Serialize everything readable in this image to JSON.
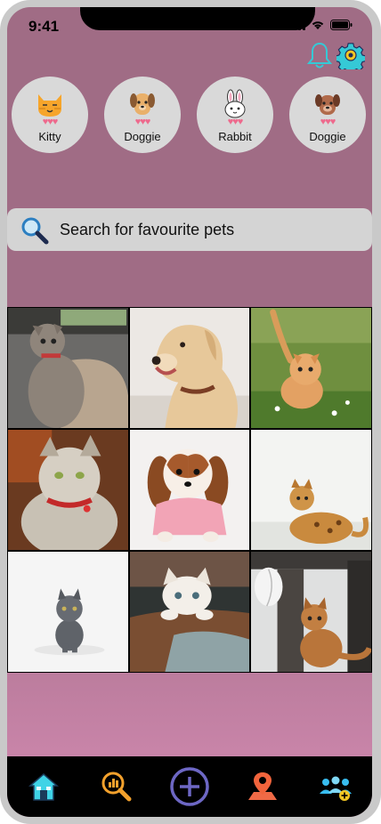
{
  "status_bar": {
    "time": "9:41"
  },
  "header_icons": [
    {
      "icon": "bell-icon",
      "color": "#35c9d6"
    },
    {
      "icon": "gear-icon",
      "color": "#35c9d6"
    }
  ],
  "categories": [
    {
      "label": "Kitty",
      "icon": "cat-face-icon"
    },
    {
      "label": "Doggie",
      "icon": "dog-face-icon"
    },
    {
      "label": "Rabbit",
      "icon": "rabbit-face-icon"
    },
    {
      "label": "Doggie",
      "icon": "dog-face-icon"
    }
  ],
  "search": {
    "placeholder": "Search for favourite pets"
  },
  "photos": [
    {
      "subject": "tabby kitten on sofa"
    },
    {
      "subject": "labrador dog"
    },
    {
      "subject": "orange kitten in grass"
    },
    {
      "subject": "long-haired cat with red collar"
    },
    {
      "subject": "spaniel puppy in pink sweater"
    },
    {
      "subject": "bengal cat"
    },
    {
      "subject": "grey kitten"
    },
    {
      "subject": "white kitten on table"
    },
    {
      "subject": "kitten with feather toy"
    }
  ],
  "bottom_nav": [
    {
      "icon": "home-icon",
      "color": "#3fd3e6"
    },
    {
      "icon": "search-chart-icon",
      "color": "#f3a12c"
    },
    {
      "icon": "add-icon",
      "color": "#6d67c4"
    },
    {
      "icon": "map-pin-icon",
      "color": "#f1643c"
    },
    {
      "icon": "community-icon",
      "color": "#38bdf0"
    }
  ]
}
